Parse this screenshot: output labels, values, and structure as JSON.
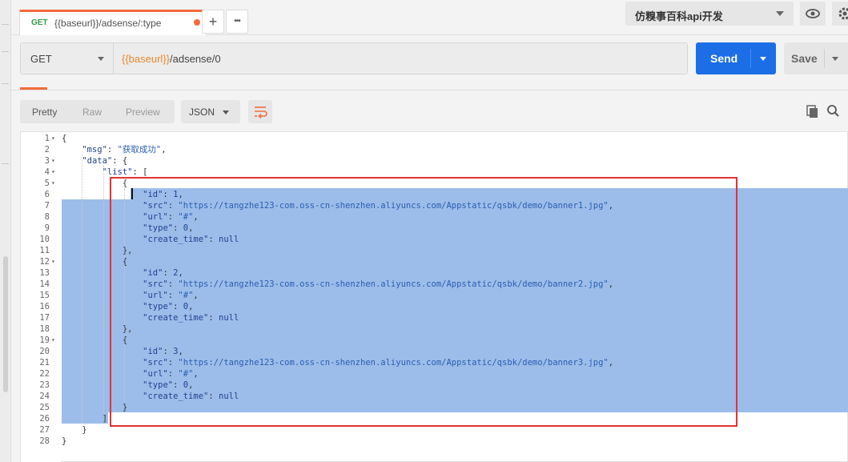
{
  "tab": {
    "method": "GET",
    "title": "{{baseurl}}/adsense/:type"
  },
  "tabbar": {
    "add_label": "+",
    "more_label": "•••"
  },
  "environment": {
    "selected": "仿糗事百科api开发"
  },
  "request": {
    "method": "GET",
    "url_var": "{{baseurl}}",
    "url_path": "/adsense/0"
  },
  "buttons": {
    "send": "Send",
    "save": "Save"
  },
  "response_toolbar": {
    "modes": [
      "Pretty",
      "Raw",
      "Preview"
    ],
    "format": "JSON"
  },
  "icons": [
    "eye-icon",
    "gear-icon",
    "wrap-icon",
    "copy-icon",
    "search-icon"
  ],
  "colors": {
    "accent": "#f26b3a",
    "send": "#1b6ee6",
    "selection": "#9cbdea",
    "highlight_box": "#e33232"
  },
  "editor": {
    "line_numbers": [
      "1",
      "2",
      "3",
      "4",
      "5",
      "6",
      "7",
      "8",
      "9",
      "10",
      "11",
      "12",
      "13",
      "14",
      "15",
      "16",
      "17",
      "18",
      "19",
      "20",
      "21",
      "22",
      "23",
      "24",
      "25",
      "26",
      "27",
      "28"
    ],
    "lines": [
      [
        {
          "t": "{",
          "c": "p"
        }
      ],
      [
        {
          "t": "    ",
          "c": "p"
        },
        {
          "t": "\"msg\"",
          "c": "k"
        },
        {
          "t": ": ",
          "c": "p"
        },
        {
          "t": "\"获取成功\"",
          "c": "s"
        },
        {
          "t": ",",
          "c": "p"
        }
      ],
      [
        {
          "t": "    ",
          "c": "p"
        },
        {
          "t": "\"data\"",
          "c": "k"
        },
        {
          "t": ": {",
          "c": "p"
        }
      ],
      [
        {
          "t": "        ",
          "c": "p"
        },
        {
          "t": "\"list\"",
          "c": "k"
        },
        {
          "t": ": [",
          "c": "p"
        }
      ],
      [
        {
          "t": "            {",
          "c": "p"
        }
      ],
      [
        {
          "t": "                ",
          "c": "p"
        },
        {
          "t": "\"id\"",
          "c": "k"
        },
        {
          "t": ": ",
          "c": "p"
        },
        {
          "t": "1",
          "c": "n"
        },
        {
          "t": ",",
          "c": "p"
        }
      ],
      [
        {
          "t": "                ",
          "c": "p"
        },
        {
          "t": "\"src\"",
          "c": "k"
        },
        {
          "t": ": ",
          "c": "p"
        },
        {
          "t": "\"https://tangzhe123-com.oss-cn-shenzhen.aliyuncs.com/Appstatic/qsbk/demo/banner1.jpg\"",
          "c": "s"
        },
        {
          "t": ",",
          "c": "p"
        }
      ],
      [
        {
          "t": "                ",
          "c": "p"
        },
        {
          "t": "\"url\"",
          "c": "k"
        },
        {
          "t": ": ",
          "c": "p"
        },
        {
          "t": "\"#\"",
          "c": "s"
        },
        {
          "t": ",",
          "c": "p"
        }
      ],
      [
        {
          "t": "                ",
          "c": "p"
        },
        {
          "t": "\"type\"",
          "c": "k"
        },
        {
          "t": ": ",
          "c": "p"
        },
        {
          "t": "0",
          "c": "n"
        },
        {
          "t": ",",
          "c": "p"
        }
      ],
      [
        {
          "t": "                ",
          "c": "p"
        },
        {
          "t": "\"create_time\"",
          "c": "k"
        },
        {
          "t": ": ",
          "c": "p"
        },
        {
          "t": "null",
          "c": "n"
        }
      ],
      [
        {
          "t": "            },",
          "c": "p"
        }
      ],
      [
        {
          "t": "            {",
          "c": "p"
        }
      ],
      [
        {
          "t": "                ",
          "c": "p"
        },
        {
          "t": "\"id\"",
          "c": "k"
        },
        {
          "t": ": ",
          "c": "p"
        },
        {
          "t": "2",
          "c": "n"
        },
        {
          "t": ",",
          "c": "p"
        }
      ],
      [
        {
          "t": "                ",
          "c": "p"
        },
        {
          "t": "\"src\"",
          "c": "k"
        },
        {
          "t": ": ",
          "c": "p"
        },
        {
          "t": "\"https://tangzhe123-com.oss-cn-shenzhen.aliyuncs.com/Appstatic/qsbk/demo/banner2.jpg\"",
          "c": "s"
        },
        {
          "t": ",",
          "c": "p"
        }
      ],
      [
        {
          "t": "                ",
          "c": "p"
        },
        {
          "t": "\"url\"",
          "c": "k"
        },
        {
          "t": ": ",
          "c": "p"
        },
        {
          "t": "\"#\"",
          "c": "s"
        },
        {
          "t": ",",
          "c": "p"
        }
      ],
      [
        {
          "t": "                ",
          "c": "p"
        },
        {
          "t": "\"type\"",
          "c": "k"
        },
        {
          "t": ": ",
          "c": "p"
        },
        {
          "t": "0",
          "c": "n"
        },
        {
          "t": ",",
          "c": "p"
        }
      ],
      [
        {
          "t": "                ",
          "c": "p"
        },
        {
          "t": "\"create_time\"",
          "c": "k"
        },
        {
          "t": ": ",
          "c": "p"
        },
        {
          "t": "null",
          "c": "n"
        }
      ],
      [
        {
          "t": "            },",
          "c": "p"
        }
      ],
      [
        {
          "t": "            {",
          "c": "p"
        }
      ],
      [
        {
          "t": "                ",
          "c": "p"
        },
        {
          "t": "\"id\"",
          "c": "k"
        },
        {
          "t": ": ",
          "c": "p"
        },
        {
          "t": "3",
          "c": "n"
        },
        {
          "t": ",",
          "c": "p"
        }
      ],
      [
        {
          "t": "                ",
          "c": "p"
        },
        {
          "t": "\"src\"",
          "c": "k"
        },
        {
          "t": ": ",
          "c": "p"
        },
        {
          "t": "\"https://tangzhe123-com.oss-cn-shenzhen.aliyuncs.com/Appstatic/qsbk/demo/banner3.jpg\"",
          "c": "s"
        },
        {
          "t": ",",
          "c": "p"
        }
      ],
      [
        {
          "t": "                ",
          "c": "p"
        },
        {
          "t": "\"url\"",
          "c": "k"
        },
        {
          "t": ": ",
          "c": "p"
        },
        {
          "t": "\"#\"",
          "c": "s"
        },
        {
          "t": ",",
          "c": "p"
        }
      ],
      [
        {
          "t": "                ",
          "c": "p"
        },
        {
          "t": "\"type\"",
          "c": "k"
        },
        {
          "t": ": ",
          "c": "p"
        },
        {
          "t": "0",
          "c": "n"
        },
        {
          "t": ",",
          "c": "p"
        }
      ],
      [
        {
          "t": "                ",
          "c": "p"
        },
        {
          "t": "\"create_time\"",
          "c": "k"
        },
        {
          "t": ": ",
          "c": "p"
        },
        {
          "t": "null",
          "c": "n"
        }
      ],
      [
        {
          "t": "            }",
          "c": "p"
        }
      ],
      [
        {
          "t": "        ]",
          "c": "p"
        }
      ],
      [
        {
          "t": "    }",
          "c": "p"
        }
      ],
      [
        {
          "t": "}",
          "c": "p"
        }
      ]
    ],
    "foldable_lines": [
      "1",
      "3",
      "4",
      "5",
      "12",
      "19"
    ]
  }
}
